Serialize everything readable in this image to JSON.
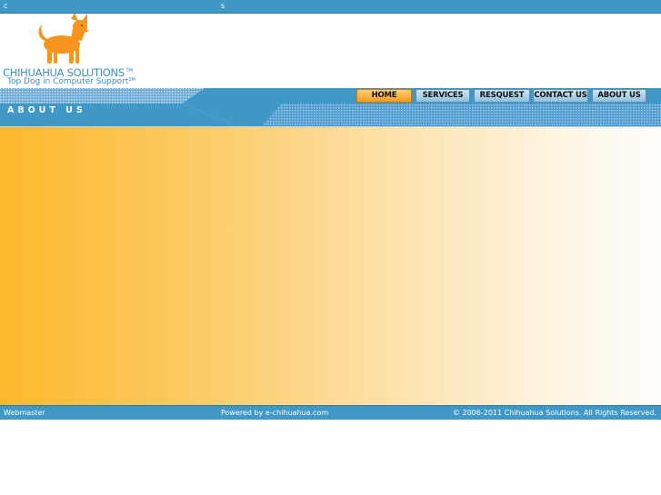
{
  "topbar": {
    "left_text": "c",
    "center_text": "s"
  },
  "logo": {
    "title": "CHIHUAHUA SOLUTIONS™",
    "tagline": "Top Dog in Computer Support",
    "tagline_mark": "SM",
    "icon": "chihuahua-dog-icon",
    "dog_color": "#f7941d"
  },
  "nav": {
    "items": [
      {
        "label": "HOME",
        "active": true
      },
      {
        "label": "SERVICES",
        "active": false
      },
      {
        "label": "RESQUEST",
        "active": false
      },
      {
        "label": "CONTACT US",
        "active": false
      },
      {
        "label": "ABOUT US",
        "active": false
      }
    ]
  },
  "section": {
    "title": "ABOUT US"
  },
  "colors": {
    "bar_blue": "#3f98c6",
    "content_orange": "#fdb82c"
  },
  "footer": {
    "webmaster": "Webmaster",
    "powered_by": "Powered by e-chihuahua.com",
    "copyright": "© 2006-2011 Chihuahua Solutions. All Rights Reserved."
  }
}
